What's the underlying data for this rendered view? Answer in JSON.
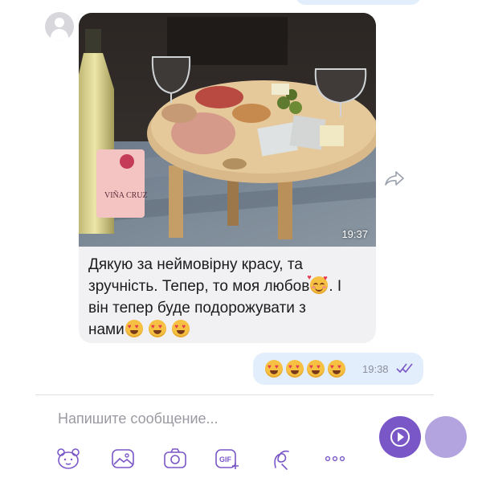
{
  "incoming": {
    "photo_time": "19:37",
    "caption_line1": "Дякую за неймовірну красу, та",
    "caption_line2": "зручність. Тепер, то моя любов",
    "caption_line2_end": ". І",
    "caption_line3": "він тепер буде подорожувати з",
    "caption_line4": "нами",
    "bottle_label": "VIÑA CRUZ"
  },
  "outgoing": {
    "time": "19:38",
    "emoji_count": 4,
    "read_status": "read"
  },
  "composer": {
    "placeholder": "Напишите сообщение..."
  },
  "toolbar": {
    "gif_label": "GIF",
    "items": [
      "sticker-icon",
      "image-icon",
      "camera-icon",
      "gif-icon",
      "doodle-icon",
      "more-icon"
    ]
  },
  "colors": {
    "incoming_bubble": "#f1f1f4",
    "outgoing_bubble": "#e3eefc",
    "accent": "#7a57c7",
    "read_ticks": "#7a57c7"
  }
}
